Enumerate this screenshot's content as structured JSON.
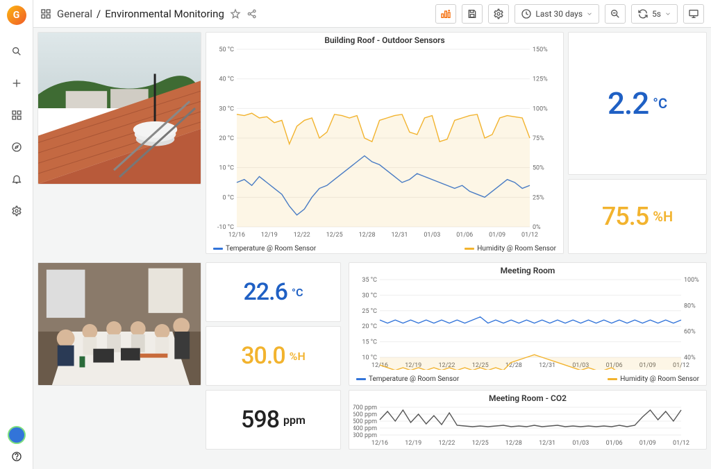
{
  "header": {
    "folder": "General",
    "title": "Environmental Monitoring",
    "timerange": "Last 30 days",
    "refresh": "5s"
  },
  "sidebar": {
    "items": [
      "search",
      "add",
      "dashboards",
      "explore",
      "alerts",
      "settings"
    ]
  },
  "stats": {
    "outdoor_temp": {
      "value": "2.2",
      "unit": "°C"
    },
    "outdoor_hum": {
      "value": "75.5",
      "unit": "%H"
    },
    "indoor_temp": {
      "value": "22.6",
      "unit": "°C"
    },
    "indoor_hum": {
      "value": "30.0",
      "unit": "%H"
    },
    "co2": {
      "value": "598",
      "unit": "ppm"
    }
  },
  "chart1": {
    "title": "Building Roof - Outdoor Sensors",
    "legend_temp": "Temperature @ Room Sensor",
    "legend_hum": "Humidity @ Room Sensor"
  },
  "chart2": {
    "title": "Meeting Room",
    "legend_temp": "Temperature @ Room Sensor",
    "legend_hum": "Humidity @ Room Sensor"
  },
  "chart3": {
    "title": "Meeting Room - CO2"
  },
  "chart_data": [
    {
      "id": "outdoor",
      "type": "line",
      "x_ticks": [
        "12/16",
        "12/19",
        "12/22",
        "12/25",
        "12/28",
        "12/31",
        "01/03",
        "01/06",
        "01/09",
        "01/12"
      ],
      "y1_label": "°C",
      "y1_ticks": [
        -10,
        0,
        10,
        20,
        30,
        40,
        50
      ],
      "y2_label": "%",
      "y2_ticks": [
        0,
        25,
        50,
        75,
        100,
        125,
        150
      ],
      "series": [
        {
          "name": "Temperature @ Room Sensor",
          "axis": "y1",
          "color": "#3274d9",
          "values": [
            5,
            6,
            4,
            7,
            5,
            3,
            1,
            -3,
            -6,
            -4,
            0,
            3,
            4,
            6,
            8,
            10,
            12,
            14,
            12,
            11,
            9,
            7,
            5,
            6,
            8,
            7,
            6,
            5,
            4,
            3,
            4,
            2,
            1,
            0,
            2,
            4,
            6,
            5,
            3,
            4
          ]
        },
        {
          "name": "Humidity @ Room Sensor",
          "axis": "y2",
          "color": "#f2b32e",
          "values": [
            95,
            94,
            96,
            92,
            93,
            88,
            90,
            70,
            85,
            90,
            92,
            75,
            80,
            95,
            94,
            92,
            94,
            75,
            72,
            90,
            92,
            94,
            95,
            80,
            78,
            92,
            94,
            72,
            74,
            90,
            92,
            94,
            95,
            75,
            78,
            92,
            94,
            93,
            92,
            75
          ]
        }
      ]
    },
    {
      "id": "meeting",
      "type": "line",
      "x_ticks": [
        "12/16",
        "12/19",
        "12/22",
        "12/25",
        "12/28",
        "12/31",
        "01/03",
        "01/06",
        "01/09",
        "01/12"
      ],
      "y1_label": "°C",
      "y1_ticks": [
        10,
        15,
        20,
        25,
        30,
        35
      ],
      "y2_label": "%",
      "y2_ticks": [
        40,
        60,
        80,
        100
      ],
      "series": [
        {
          "name": "Temperature @ Room Sensor",
          "axis": "y1",
          "color": "#3274d9",
          "values": [
            22,
            21,
            22,
            21,
            22,
            21,
            22,
            21,
            22,
            21,
            22,
            21,
            22,
            23,
            21,
            22,
            21,
            22,
            21,
            22,
            21,
            22,
            21,
            22,
            21,
            22,
            21,
            22,
            21,
            22,
            21,
            22,
            21,
            22,
            21,
            22,
            21,
            22,
            21,
            22
          ]
        },
        {
          "name": "Humidity @ Room Sensor",
          "axis": "y2",
          "color": "#f2b32e",
          "values": [
            34,
            32,
            30,
            32,
            30,
            32,
            30,
            32,
            30,
            32,
            30,
            32,
            30,
            32,
            30,
            32,
            30,
            36,
            38,
            40,
            42,
            40,
            38,
            36,
            34,
            32,
            30,
            32,
            30,
            30,
            32,
            28,
            30,
            28,
            30,
            28,
            30,
            28,
            30,
            30
          ]
        }
      ]
    },
    {
      "id": "co2",
      "type": "line",
      "x_ticks": [
        "12/16",
        "12/19",
        "12/22",
        "12/25",
        "12/28",
        "12/31",
        "01/03",
        "01/06",
        "01/09",
        "01/12"
      ],
      "y1_label": "ppm",
      "y1_ticks": [
        300,
        400,
        500,
        600,
        700
      ],
      "series": [
        {
          "name": "CO2",
          "axis": "y1",
          "color": "#555",
          "values": [
            520,
            640,
            500,
            660,
            480,
            600,
            460,
            580,
            450,
            620,
            440,
            430,
            420,
            430,
            420,
            430,
            440,
            420,
            430,
            420,
            440,
            420,
            430,
            440,
            420,
            430,
            420,
            430,
            420,
            430,
            420,
            440,
            420,
            440,
            560,
            660,
            520,
            640,
            500,
            660
          ]
        }
      ]
    }
  ]
}
